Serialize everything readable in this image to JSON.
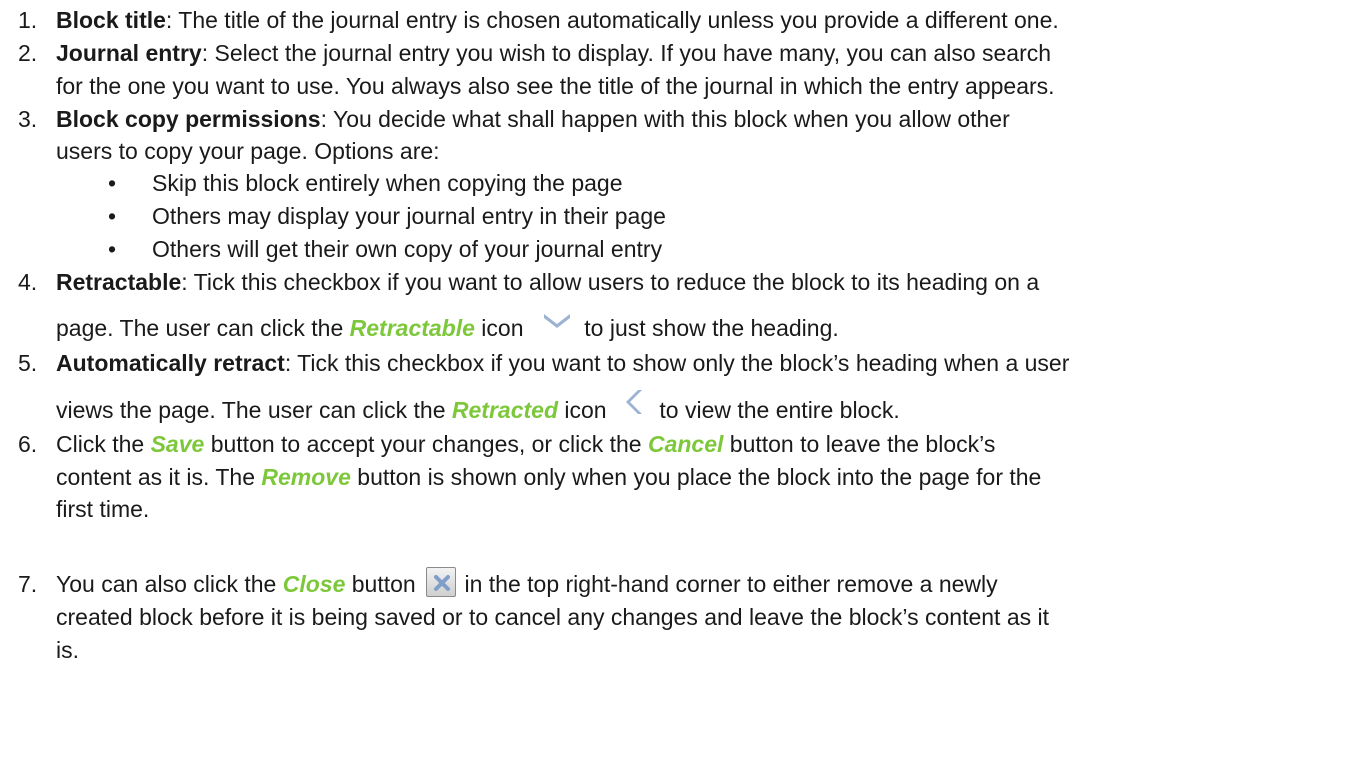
{
  "items": [
    {
      "num": "1.",
      "term": "Block title",
      "text": ": The title of the journal entry is chosen automatically unless you provide a different one."
    },
    {
      "num": "2.",
      "term": "Journal entry",
      "text_1": ": Select the journal entry you wish to display. If you have many, you can also search",
      "text_2": "for the one you want to use. You always also see the title of the journal in which the entry appears."
    },
    {
      "num": "3.",
      "term": "Block copy permissions",
      "text_1": ": You decide what shall happen with this block when you allow other",
      "text_2": "users to copy your page. Options are:",
      "options": [
        "Skip this block entirely when copying the page",
        "Others may display your journal entry in their page",
        "Others will get their own copy of your journal entry"
      ]
    },
    {
      "num": "4.",
      "term": "Retractable",
      "text_1": ": Tick this checkbox if you want to allow users to reduce the block to its heading on a",
      "text_2a": "page. The user can click the ",
      "em": "Retractable",
      "text_2b": " icon",
      "text_2c": " to just show the heading.",
      "icon": "chevron-down-icon"
    },
    {
      "num": "5.",
      "term": "Automatically retract",
      "text_1": ": Tick this checkbox if you want to show only the block’s heading when a user",
      "text_2a": "views the page. The user can click the ",
      "em": "Retracted",
      "text_2b": " icon",
      "text_2c": " to view the entire block.",
      "icon": "chevron-left-icon"
    },
    {
      "num": "6.",
      "line1_a": "Click the ",
      "save": "Save",
      "line1_b": " button to accept your changes, or click the ",
      "cancel": "Cancel",
      "line1_c": " button to leave the block’s",
      "line2_a": "content as it is. The ",
      "remove": "Remove",
      "line2_b": " button is shown only when you place the block into the page for the",
      "line3": "first time."
    },
    {
      "num": "7.",
      "line1_a": "You can also click the ",
      "close": "Close",
      "line1_b": " button",
      "line1_c": " in the top right-hand corner to either remove a newly",
      "line2": "created block before it is being saved or to cancel any changes and leave the block’s content as it",
      "line3": "is.",
      "icon": "close-icon"
    }
  ],
  "colors": {
    "emphasis": "#7dc83a",
    "text": "#1a1a1a",
    "icon": "#9cb3d4"
  }
}
